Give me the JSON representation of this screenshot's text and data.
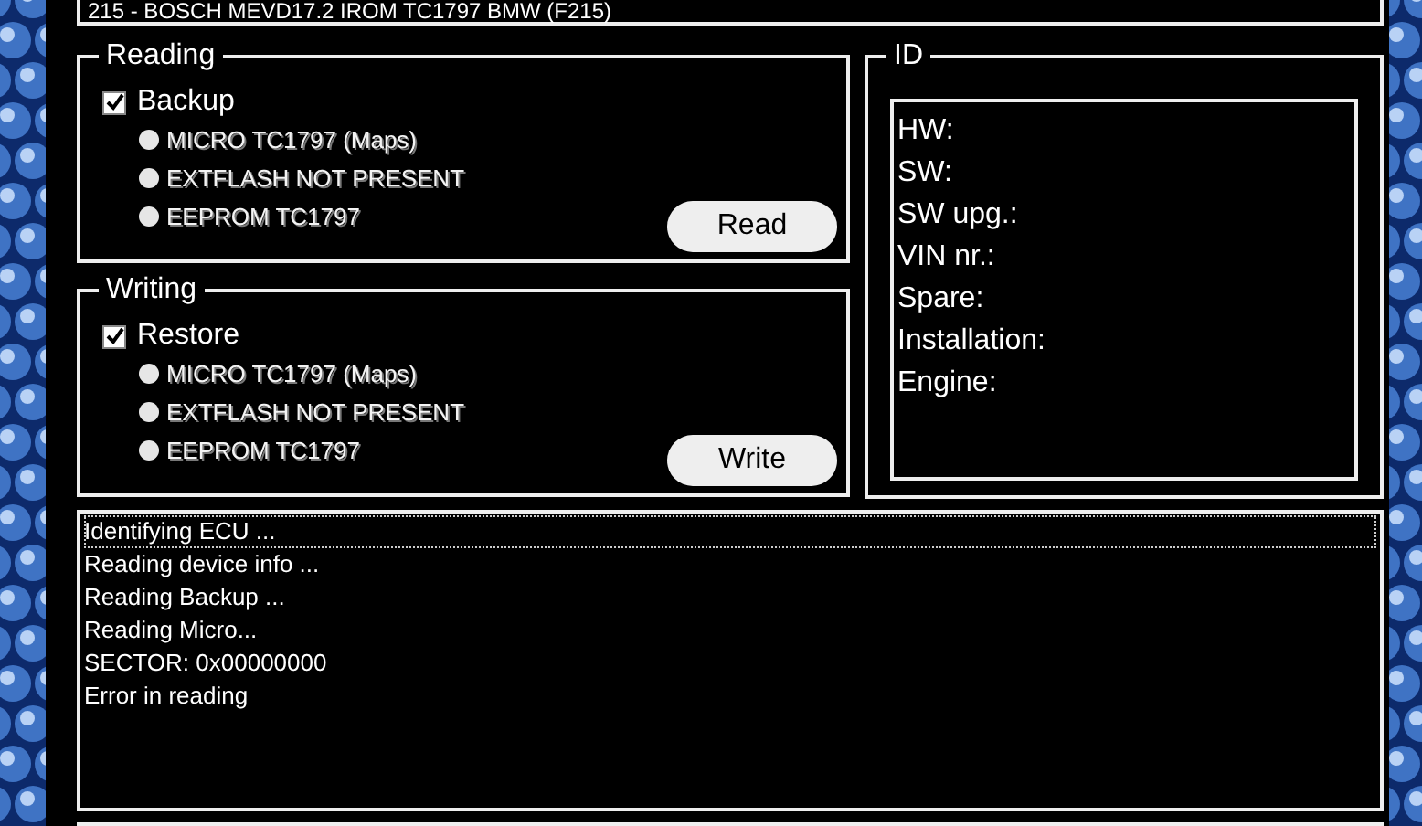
{
  "header": {
    "text": "215 - BOSCH MEVD17.2 IROM TC1797 BMW (F215)"
  },
  "reading": {
    "title": "Reading",
    "checkbox": {
      "label": "Backup",
      "checked": true
    },
    "options": [
      {
        "label": "MICRO TC1797 (Maps)",
        "selected": false,
        "disabled": true
      },
      {
        "label": "EXTFLASH NOT PRESENT",
        "selected": false,
        "disabled": true
      },
      {
        "label": "EEPROM TC1797",
        "selected": false,
        "disabled": true
      }
    ],
    "button": "Read"
  },
  "writing": {
    "title": "Writing",
    "checkbox": {
      "label": "Restore",
      "checked": true
    },
    "options": [
      {
        "label": "MICRO TC1797 (Maps)",
        "selected": false,
        "disabled": true
      },
      {
        "label": "EXTFLASH NOT PRESENT",
        "selected": false,
        "disabled": true
      },
      {
        "label": "EEPROM TC1797",
        "selected": false,
        "disabled": true
      }
    ],
    "button": "Write"
  },
  "id": {
    "title": "ID",
    "fields": [
      "HW:",
      "SW:",
      "SW upg.:",
      "VIN nr.:",
      "Spare:",
      "Installation:",
      "Engine:"
    ]
  },
  "log": [
    {
      "text": "Identifying ECU ...",
      "selected": true
    },
    {
      "text": "Reading device info ...",
      "selected": false
    },
    {
      "text": "Reading Backup ...",
      "selected": false
    },
    {
      "text": "Reading Micro...",
      "selected": false
    },
    {
      "text": "SECTOR: 0x00000000",
      "selected": false
    },
    {
      "text": "Error in reading",
      "selected": false
    }
  ]
}
